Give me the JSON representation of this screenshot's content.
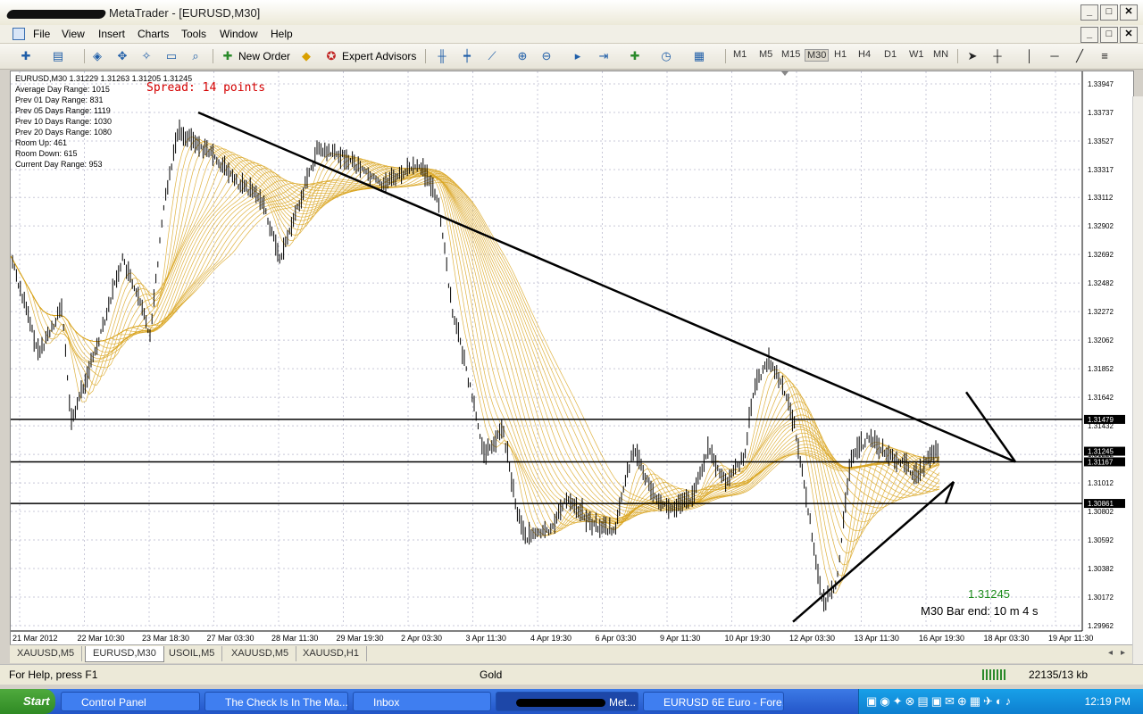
{
  "window": {
    "title": "MetaTrader - [EURUSD,M30]",
    "min": "_",
    "max": "□",
    "close": "✕"
  },
  "menu": [
    "File",
    "View",
    "Insert",
    "Charts",
    "Tools",
    "Window",
    "Help"
  ],
  "toolbar": {
    "new_order": "New Order",
    "expert_advisors": "Expert Advisors",
    "timeframes": [
      "M1",
      "M5",
      "M15",
      "M30",
      "H1",
      "H4",
      "D1",
      "W1",
      "MN"
    ],
    "selected_timeframe": "M30"
  },
  "chart": {
    "symbol_line": "EURUSD,M30  1.31229 1.31263 1.31205 1.31245",
    "info_lines": [
      "Average Day  Range: 1015",
      "Prev 01  Day  Range: 831",
      "Prev 05  Days Range: 1119",
      "Prev 10  Days Range: 1030",
      "Prev 20  Days Range: 1080",
      "Room Up:     461",
      "Room Down: 615",
      "Current  Day Range: 953"
    ],
    "spread": "Spread: 14 points",
    "last_price": "1.31245",
    "bar_end": "M30 Bar end:  10 m 4 s",
    "price_labels": [
      "1.33947",
      "1.33737",
      "1.33527",
      "1.33317",
      "1.33112",
      "1.32902",
      "1.32692",
      "1.32482",
      "1.32272",
      "1.32062",
      "1.31852",
      "1.31642",
      "1.31432",
      "1.31222",
      "1.31012",
      "1.30802",
      "1.30592",
      "1.30382",
      "1.30172",
      "1.29962"
    ],
    "hline_labels": [
      "1.31479",
      "1.31245",
      "1.31167",
      "1.30861"
    ],
    "time_labels": [
      "21 Mar 2012",
      "22 Mar 10:30",
      "23 Mar 18:30",
      "27 Mar 03:30",
      "28 Mar 11:30",
      "29 Mar 19:30",
      "2 Apr 03:30",
      "3 Apr 11:30",
      "4 Apr 19:30",
      "6 Apr 03:30",
      "9 Apr 11:30",
      "10 Apr 19:30",
      "12 Apr 03:30",
      "13 Apr 11:30",
      "16 Apr 19:30",
      "18 Apr 03:30",
      "19 Apr 11:30"
    ],
    "ribbon_color": "#d9a520",
    "candle_color": "#000000"
  },
  "tabs": [
    "XAUUSD,M5",
    "EURUSD,M30",
    "USOIL,M5",
    "XAUUSD,M5",
    "XAUUSD,H1"
  ],
  "active_tab": "EURUSD,M30",
  "status": {
    "help": "For Help, press F1",
    "profile": "Gold",
    "traffic": "22135/13 kb"
  },
  "taskbar": {
    "start": "Start",
    "items": [
      "Control Panel",
      "The Check Is In The Ma...",
      "Inbox",
      "Met...",
      "EURUSD 6E Euro - Fore..."
    ],
    "clock": "12:19 PM"
  }
}
